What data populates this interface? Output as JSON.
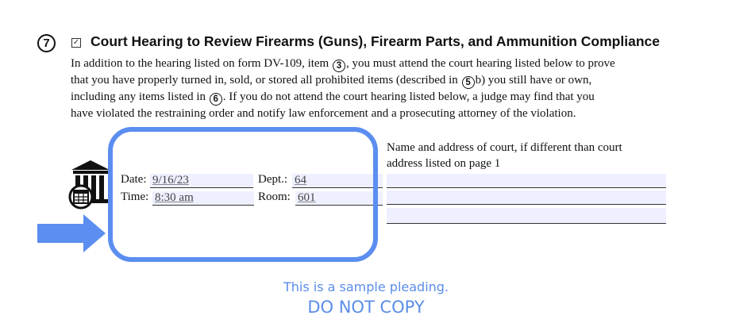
{
  "section": {
    "number": "7",
    "checkbox_mark": "✓",
    "title": "Court Hearing to Review Firearms (Guns), Firearm Parts, and Ammunition Compliance",
    "para_lines": [
      {
        "a": "In addition to the hearing listed on form DV-109, item ",
        "circle": "3",
        "b": ", you must attend the court hearing listed below to prove"
      },
      {
        "a": "that you have properly turned in, sold, or stored all prohibited items (described in ",
        "circle": "5",
        "b": "b) you still have or own,"
      },
      {
        "a": "including any items listed in ",
        "circle": "6",
        "b": ". If you do not attend the court hearing listed below, a judge may find that you"
      },
      {
        "a": "have violated the restraining order and notify law enforcement and a prosecuting attorney of the violation.",
        "circle": "",
        "b": ""
      }
    ]
  },
  "hearing": {
    "date_label": "Date:",
    "date_value": "9/16/23",
    "time_label": "Time:",
    "time_value": "8:30 am",
    "dept_label": "Dept.:",
    "dept_value": "64",
    "room_label": "Room:",
    "room_value": "601"
  },
  "court_address": {
    "label_line1": "Name and address of court, if different than court",
    "label_line2": "address listed on page 1"
  },
  "icons": [
    "courthouse-calendar-icon",
    "arrow-right-icon"
  ],
  "colors": {
    "highlight": "#5b8ef0",
    "field_bg": "#eef0ff",
    "notice": "#5a8de8"
  },
  "notice": {
    "line1": "This is a sample pleading.",
    "line2": "DO NOT COPY"
  }
}
